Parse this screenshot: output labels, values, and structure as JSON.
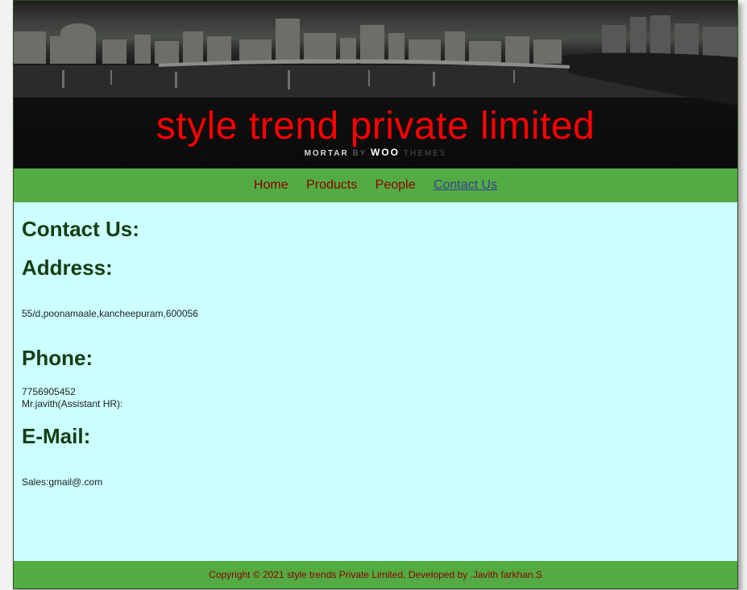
{
  "banner": {
    "title": "style trend private limited",
    "subtitle_part1": "MORTAR",
    "subtitle_part2": "BY",
    "subtitle_part3": "WOO",
    "subtitle_part4": "THEMES"
  },
  "nav": {
    "items": [
      {
        "label": "Home"
      },
      {
        "label": "Products"
      },
      {
        "label": "People"
      },
      {
        "label": "Contact Us",
        "active": true
      }
    ]
  },
  "main": {
    "heading": "Contact Us:",
    "address_heading": "Address:",
    "address_text": "55/d,poonamaale,kancheepuram,600056",
    "phone_heading": "Phone:",
    "phone_number": "7756905452",
    "phone_contact": "Mr.javith(Assistant HR):",
    "email_heading": "E-Mail:",
    "email_text": "Sales:gmail@.com"
  },
  "footer": {
    "text": "Copyright © 2021 style trends Private Limited, Developed by .Javith farkhan.S"
  },
  "colors": {
    "nav_bg": "#52ac43",
    "content_bg": "#ccffff",
    "title_red": "#ff0000",
    "link_dark_red": "#8b0000",
    "heading_green": "#143d14"
  }
}
